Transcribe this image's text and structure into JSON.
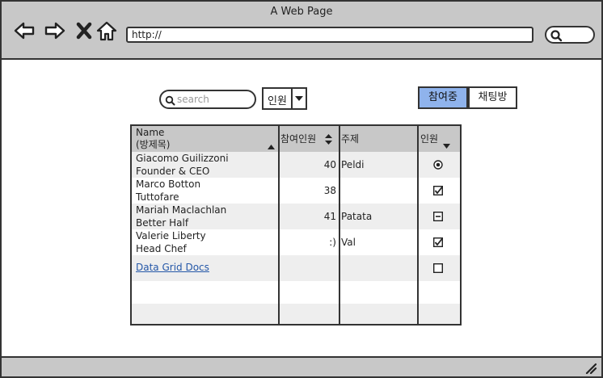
{
  "window": {
    "title": "A Web Page",
    "url": "http://"
  },
  "controls": {
    "search_placeholder": "search",
    "dropdown_value": "인원",
    "segments": [
      "참여중",
      "채팅방"
    ],
    "active_segment": "참여중"
  },
  "grid": {
    "columns": [
      {
        "label": "Name\n(방제목)",
        "sort": "ascending"
      },
      {
        "label": "참여인원",
        "sort": "both"
      },
      {
        "label": "주제",
        "sort": "none"
      },
      {
        "label": "인원",
        "sort": "dropdown"
      }
    ],
    "rows": [
      {
        "name": "Giacomo Guilizzoni",
        "sub": "Founder & CEO",
        "count": "40",
        "topic": "Peldi",
        "control": "radio-selected"
      },
      {
        "name": "Marco Botton",
        "sub": "Tuttofare",
        "count": "38",
        "topic": "",
        "control": "checkbox-checked"
      },
      {
        "name": "Mariah Maclachlan",
        "sub": "Better Half",
        "count": "41",
        "topic": "Patata",
        "control": "checkbox-indeterminate"
      },
      {
        "name": "Valerie Liberty",
        "sub": "Head Chef",
        "count": ":)",
        "topic": "Val",
        "control": "checkbox-checked"
      },
      {
        "name": "Data Grid Docs",
        "sub": "",
        "count": "",
        "topic": "",
        "control": "checkbox-empty",
        "is_link": true
      }
    ]
  }
}
